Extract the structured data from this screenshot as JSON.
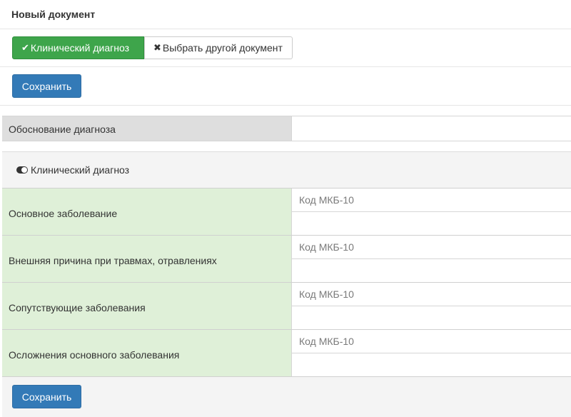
{
  "header": {
    "title": "Новый документ"
  },
  "tabs": {
    "clinical": {
      "icon": "check-icon",
      "glyph": "✔",
      "label": "Клинический диагноз"
    },
    "choose_other": {
      "icon": "close-icon",
      "glyph": "✖",
      "label": "Выбрать другой документ"
    }
  },
  "toolbar": {
    "save_label": "Сохранить"
  },
  "justification": {
    "label": "Обоснование диагноза",
    "value": ""
  },
  "section": {
    "title": "Клинический диагноз",
    "toggle_icon": "toggle-icon",
    "rows": [
      {
        "label": "Основное заболевание",
        "code_placeholder": "Код МКБ-10",
        "name_value": ""
      },
      {
        "label": "Внешняя причина при травмах, отравлениях",
        "code_placeholder": "Код МКБ-10",
        "name_value": ""
      },
      {
        "label": "Сопутствующие заболевания",
        "code_placeholder": "Код МКБ-10",
        "name_value": ""
      },
      {
        "label": "Осложнения основного заболевания",
        "code_placeholder": "Код МКБ-10",
        "name_value": ""
      }
    ]
  },
  "footer": {
    "save_label": "Сохранить"
  },
  "colors": {
    "success": "#3ea54b",
    "primary": "#337ab7",
    "row_green": "#dff0d8",
    "label_gray": "#dedede"
  }
}
